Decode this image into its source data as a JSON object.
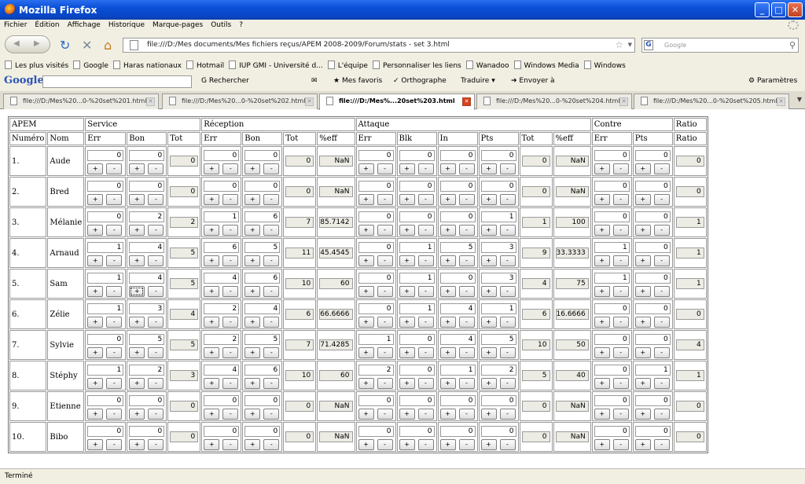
{
  "window": {
    "title": "Mozilla Firefox",
    "min": "_",
    "max": "□",
    "close": "✕"
  },
  "menu": [
    "Fichier",
    "Édition",
    "Affichage",
    "Historique",
    "Marque-pages",
    "Outils",
    "?"
  ],
  "nav": {
    "url": "file:///D:/Mes documents/Mes fichiers reçus/APEM 2008-2009/Forum/stats - set 3.html",
    "search_placeholder": "Google"
  },
  "bookmarks": [
    "Les plus visités",
    "Google",
    "Haras nationaux",
    "Hotmail",
    "IUP GMI - Université d...",
    "L'équipe",
    "Personnaliser les liens",
    "Wanadoo",
    "Windows Media",
    "Windows"
  ],
  "google_toolbar": {
    "logo": "Google",
    "search": "Rechercher",
    "favoris": "Mes favoris",
    "ortho": "Orthographe",
    "traduire": "Traduire",
    "envoyer": "Envoyer à",
    "params": "Paramètres"
  },
  "tabs": [
    {
      "label": "file:///D:/Mes%20...0-%20set%201.html",
      "active": false
    },
    {
      "label": "file:///D:/Mes%20...0-%20set%202.html",
      "active": false
    },
    {
      "label": "file:///D:/Mes%...20set%203.html",
      "active": true
    },
    {
      "label": "file:///D:/Mes%20...0-%20set%204.html",
      "active": false
    },
    {
      "label": "file:///D:/Mes%20...0-%20set%205.html",
      "active": false
    }
  ],
  "table": {
    "groups": [
      {
        "label": "APEM",
        "span": 2
      },
      {
        "label": "Service",
        "span": 3
      },
      {
        "label": "Réception",
        "span": 4
      },
      {
        "label": "Attaque",
        "span": 6
      },
      {
        "label": "Contre",
        "span": 2
      },
      {
        "label": "Ratio",
        "span": 1
      }
    ],
    "columns": [
      "Numéro",
      "Nom",
      "Err",
      "Bon",
      "Tot",
      "Err",
      "Bon",
      "Tot",
      "%eff",
      "Err",
      "Blk",
      "In",
      "Pts",
      "Tot",
      "%eff",
      "Err",
      "Pts",
      "Ratio"
    ],
    "plus": "+",
    "minus": "-",
    "rows": [
      {
        "num": "1.",
        "name": "Aude",
        "s_err": "0",
        "s_bon": "0",
        "s_tot": "0",
        "r_err": "0",
        "r_bon": "0",
        "r_tot": "0",
        "r_eff": "NaN",
        "a_err": "0",
        "a_blk": "0",
        "a_in": "0",
        "a_pts": "0",
        "a_tot": "0",
        "a_eff": "NaN",
        "c_err": "0",
        "c_pts": "0",
        "ratio": "0"
      },
      {
        "num": "2.",
        "name": "Bred",
        "s_err": "0",
        "s_bon": "0",
        "s_tot": "0",
        "r_err": "0",
        "r_bon": "0",
        "r_tot": "0",
        "r_eff": "NaN",
        "a_err": "0",
        "a_blk": "0",
        "a_in": "0",
        "a_pts": "0",
        "a_tot": "0",
        "a_eff": "NaN",
        "c_err": "0",
        "c_pts": "0",
        "ratio": "0"
      },
      {
        "num": "3.",
        "name": "Mélanie",
        "s_err": "0",
        "s_bon": "2",
        "s_tot": "2",
        "r_err": "1",
        "r_bon": "6",
        "r_tot": "7",
        "r_eff": "85.7142",
        "a_err": "0",
        "a_blk": "0",
        "a_in": "0",
        "a_pts": "1",
        "a_tot": "1",
        "a_eff": "100",
        "c_err": "0",
        "c_pts": "0",
        "ratio": "1"
      },
      {
        "num": "4.",
        "name": "Arnaud",
        "s_err": "1",
        "s_bon": "4",
        "s_tot": "5",
        "r_err": "6",
        "r_bon": "5",
        "r_tot": "11",
        "r_eff": "45.4545",
        "a_err": "0",
        "a_blk": "1",
        "a_in": "5",
        "a_pts": "3",
        "a_tot": "9",
        "a_eff": "33.3333",
        "c_err": "1",
        "c_pts": "0",
        "ratio": "1"
      },
      {
        "num": "5.",
        "name": "Sam",
        "s_err": "1",
        "s_bon": "4",
        "s_tot": "5",
        "r_err": "4",
        "r_bon": "6",
        "r_tot": "10",
        "r_eff": "60",
        "a_err": "0",
        "a_blk": "1",
        "a_in": "0",
        "a_pts": "3",
        "a_tot": "4",
        "a_eff": "75",
        "c_err": "1",
        "c_pts": "0",
        "ratio": "1"
      },
      {
        "num": "6.",
        "name": "Zélie",
        "s_err": "1",
        "s_bon": "3",
        "s_tot": "4",
        "r_err": "2",
        "r_bon": "4",
        "r_tot": "6",
        "r_eff": "66.6666",
        "a_err": "0",
        "a_blk": "1",
        "a_in": "4",
        "a_pts": "1",
        "a_tot": "6",
        "a_eff": "16.6666",
        "c_err": "0",
        "c_pts": "0",
        "ratio": "0"
      },
      {
        "num": "7.",
        "name": "Sylvie",
        "s_err": "0",
        "s_bon": "5",
        "s_tot": "5",
        "r_err": "2",
        "r_bon": "5",
        "r_tot": "7",
        "r_eff": "71.4285",
        "a_err": "1",
        "a_blk": "0",
        "a_in": "4",
        "a_pts": "5",
        "a_tot": "10",
        "a_eff": "50",
        "c_err": "0",
        "c_pts": "0",
        "ratio": "4"
      },
      {
        "num": "8.",
        "name": "Stéphy",
        "s_err": "1",
        "s_bon": "2",
        "s_tot": "3",
        "r_err": "4",
        "r_bon": "6",
        "r_tot": "10",
        "r_eff": "60",
        "a_err": "2",
        "a_blk": "0",
        "a_in": "1",
        "a_pts": "2",
        "a_tot": "5",
        "a_eff": "40",
        "c_err": "0",
        "c_pts": "1",
        "ratio": "1"
      },
      {
        "num": "9.",
        "name": "Etienne",
        "s_err": "0",
        "s_bon": "0",
        "s_tot": "0",
        "r_err": "0",
        "r_bon": "0",
        "r_tot": "0",
        "r_eff": "NaN",
        "a_err": "0",
        "a_blk": "0",
        "a_in": "0",
        "a_pts": "0",
        "a_tot": "0",
        "a_eff": "NaN",
        "c_err": "0",
        "c_pts": "0",
        "ratio": "0"
      },
      {
        "num": "10.",
        "name": "Bibo",
        "s_err": "0",
        "s_bon": "0",
        "s_tot": "0",
        "r_err": "0",
        "r_bon": "0",
        "r_tot": "0",
        "r_eff": "NaN",
        "a_err": "0",
        "a_blk": "0",
        "a_in": "0",
        "a_pts": "0",
        "a_tot": "0",
        "a_eff": "NaN",
        "c_err": "0",
        "c_pts": "0",
        "ratio": "0"
      }
    ]
  },
  "status": "Terminé"
}
